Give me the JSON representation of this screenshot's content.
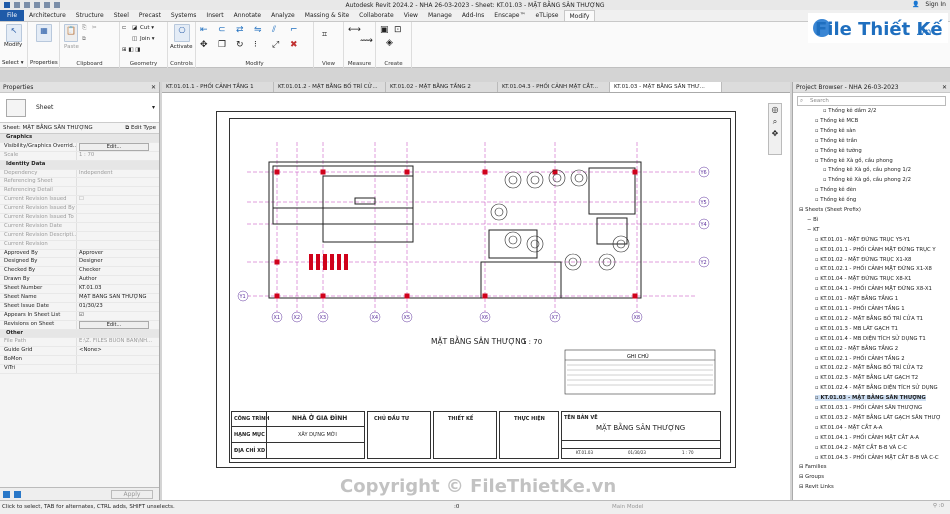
{
  "title_bar": {
    "title": "Autodesk Revit 2024.2 - NHA 26-03-2023 - Sheet: KT.01.03 - MẶT BẰNG SÂN THƯỢNG",
    "sign_in": "Sign In"
  },
  "menu": [
    "File",
    "Architecture",
    "Structure",
    "Steel",
    "Precast",
    "Systems",
    "Insert",
    "Annotate",
    "Analyze",
    "Massing & Site",
    "Collaborate",
    "View",
    "Manage",
    "Add-Ins",
    "Enscape™",
    "eTLipse",
    "Modify"
  ],
  "active_menu": "Modify",
  "ribbon": {
    "select_label": "Select ▾",
    "modify_label": "Modify",
    "properties_label": "Properties",
    "clipboard_label": "Clipboard",
    "paste_label": "Paste",
    "cut_label": "Cut ▾",
    "join_label": "Join ▾",
    "geometry_label": "Geometry",
    "controls_label": "Controls",
    "activate_label": "Activate",
    "modify_group_label": "Modify",
    "view_label": "View",
    "measure_label": "Measure",
    "create_label": "Create"
  },
  "tabs": [
    {
      "label": "KT.01.01.1 - PHỐI CẢNH TẦNG 1"
    },
    {
      "label": "KT.01.01.2 - MẶT BẰNG BỐ TRÍ CỬ..."
    },
    {
      "label": "KT.01.02 - MẶT BẰNG TẦNG 2"
    },
    {
      "label": "KT.01.04.3 - PHỐI CẢNH MẶT CẮT..."
    },
    {
      "label": "KT.01.03 - MẶT BẰNG SÂN THƯ..."
    }
  ],
  "properties": {
    "header": "Properties",
    "type_name": "Sheet",
    "selector": "Sheet: MẶT BẰNG SÂN THƯỢNG",
    "edit_type": "Edit Type",
    "rows": [
      {
        "k": "Graphics",
        "v": "",
        "sec": true
      },
      {
        "k": "Visibility/Graphics Overrid...",
        "v": "Edit...",
        "btn": true
      },
      {
        "k": "Scale",
        "v": "1 : 70",
        "dim": true
      },
      {
        "k": "Identity Data",
        "v": "",
        "sec": true
      },
      {
        "k": "Dependency",
        "v": "Independent",
        "dim": true
      },
      {
        "k": "Referencing Sheet",
        "v": "",
        "dim": true
      },
      {
        "k": "Referencing Detail",
        "v": "",
        "dim": true
      },
      {
        "k": "Current Revision Issued",
        "v": "☐",
        "dim": true
      },
      {
        "k": "Current Revision Issued By",
        "v": "",
        "dim": true
      },
      {
        "k": "Current Revision Issued To",
        "v": "",
        "dim": true
      },
      {
        "k": "Current Revision Date",
        "v": "",
        "dim": true
      },
      {
        "k": "Current Revision Descripti...",
        "v": "",
        "dim": true
      },
      {
        "k": "Current Revision",
        "v": "",
        "dim": true
      },
      {
        "k": "Approved By",
        "v": "Approver"
      },
      {
        "k": "Designed By",
        "v": "Designer"
      },
      {
        "k": "Checked By",
        "v": "Checker"
      },
      {
        "k": "Drawn By",
        "v": "Author"
      },
      {
        "k": "Sheet Number",
        "v": "KT.01.03"
      },
      {
        "k": "Sheet Name",
        "v": "MẶT BẰNG SÂN THƯỢNG"
      },
      {
        "k": "Sheet Issue Date",
        "v": "01/30/23"
      },
      {
        "k": "Appears In Sheet List",
        "v": "☑"
      },
      {
        "k": "Revisions on Sheet",
        "v": "Edit...",
        "btn": true
      },
      {
        "k": "Other",
        "v": "",
        "sec": true
      },
      {
        "k": "File Path",
        "v": "E:\\Z. FILES BUON BAN\\NH...",
        "dim": true
      },
      {
        "k": "Guide Grid",
        "v": "<None>"
      },
      {
        "k": "BoMon",
        "v": ""
      },
      {
        "k": "ViTri",
        "v": ""
      }
    ],
    "apply": "Apply"
  },
  "drawing": {
    "plan_title": "MẶT BẰNG SÂN THƯỢNG",
    "plan_scale": "1 : 70",
    "grid_x": [
      "X1",
      "X2",
      "X3",
      "X4",
      "X5",
      "X6",
      "X7",
      "X8"
    ],
    "grid_y": [
      "Y6",
      "Y5",
      "Y4",
      "Y2",
      "Y1"
    ],
    "notes_title": "GHI CHÚ",
    "titleblock": {
      "cong_trinh_label": "CÔNG TRÌNH",
      "cong_trinh_value": "NHÀ Ở GIA ĐÌNH",
      "hang_muc_label": "HẠNG MỤC",
      "hang_muc_value": "XÂY DỰNG MỚI",
      "dia_chi_label": "ĐỊA CHỈ XD",
      "chu_dau_tu": "CHỦ ĐẦU TƯ",
      "thiet_ke": "THIẾT KẾ",
      "thuc_hien": "THỰC HIỆN",
      "ten_ban_ve_label": "TÊN BẢN VẼ",
      "ten_ban_ve_value": "MẶT BẰNG SÂN THƯỢNG",
      "sheet_no": "KT.01.03",
      "date": "01/30/23",
      "scale": "1 : 70"
    }
  },
  "project_browser": {
    "header": "Project Browser - NHA 26-03-2023",
    "search_placeholder": "Search",
    "items": [
      {
        "t": "Thống kê dầm 2/2",
        "ind": 3
      },
      {
        "t": "Thống kê MCB",
        "ind": 2
      },
      {
        "t": "Thống kê sàn",
        "ind": 2
      },
      {
        "t": "Thống kê trần",
        "ind": 2
      },
      {
        "t": "Thống kê tường",
        "ind": 2
      },
      {
        "t": "Thống kê Xà gồ, cầu phong",
        "ind": 2
      },
      {
        "t": "Thống kê Xà gồ, cầu phong 1/2",
        "ind": 3
      },
      {
        "t": "Thống kê Xà gồ, cầu phong 2/2",
        "ind": 3
      },
      {
        "t": "Thống kê đèn",
        "ind": 2
      },
      {
        "t": "Thống kê ống",
        "ind": 2
      },
      {
        "t": "Sheets (Sheet Prefix)",
        "ind": 0
      },
      {
        "t": "Bì",
        "ind": 1
      },
      {
        "t": "KT",
        "ind": 1
      },
      {
        "t": "KT.01.01 - MẶT ĐỨNG TRỤC Y5-Y1",
        "ind": 2
      },
      {
        "t": "KT.01.01.1 - PHỐI CẢNH MẶT ĐỨNG TRỤC Y",
        "ind": 2
      },
      {
        "t": "KT.01.02 - MẶT ĐỨNG TRỤC X1-X8",
        "ind": 2
      },
      {
        "t": "KT.01.02.1 - PHỐI CẢNH MẶT ĐỨNG X1-X8",
        "ind": 2
      },
      {
        "t": "KT.01.04 - MẶT ĐỨNG TRỤC X8-X1",
        "ind": 2
      },
      {
        "t": "KT.01.04.1 - PHỐI CẢNH MẶT ĐỨNG X8-X1",
        "ind": 2
      },
      {
        "t": "KT.01.01 - MẶT BẰNG TẦNG 1",
        "ind": 2
      },
      {
        "t": "KT.01.01.1 - PHỐI CẢNH TẦNG 1",
        "ind": 2
      },
      {
        "t": "KT.01.01.2 - MẶT BẰNG BỐ TRÍ CỬA T1",
        "ind": 2
      },
      {
        "t": "KT.01.01.3 - MB LÁT GẠCH T1",
        "ind": 2
      },
      {
        "t": "KT.01.01.4 - MB DIỆN TÍCH SỬ DỤNG T1",
        "ind": 2
      },
      {
        "t": "KT.01.02 - MẶT BẰNG TẦNG 2",
        "ind": 2
      },
      {
        "t": "KT.01.02.1 - PHỐI CẢNH TẦNG 2",
        "ind": 2
      },
      {
        "t": "KT.01.02.2 - MẶT BẰNG BỐ TRÍ CỬA T2",
        "ind": 2
      },
      {
        "t": "KT.01.02.3 - MẶT BẰNG LÁT GẠCH T2",
        "ind": 2
      },
      {
        "t": "KT.01.02.4 - MẶT BẰNG DIỆN TÍCH SỬ DỤNG",
        "ind": 2
      },
      {
        "t": "KT.01.03 - MẶT BẰNG SÂN THƯỢNG",
        "ind": 2,
        "sel": true
      },
      {
        "t": "KT.01.03.1 - PHỐI CẢNH SÂN THƯỢNG",
        "ind": 2
      },
      {
        "t": "KT.01.03.2 - MẶT BẰNG LÁT GẠCH SÂN THƯỢ",
        "ind": 2
      },
      {
        "t": "KT.01.04 - MẶT CẮT A-A",
        "ind": 2
      },
      {
        "t": "KT.01.04.1 - PHỐI CẢNH MẶT CẮT A-A",
        "ind": 2
      },
      {
        "t": "KT.01.04.2 - MẶT CẮT B-B VÀ C-C",
        "ind": 2
      },
      {
        "t": "KT.01.04.3 - PHỐI CẢNH MẶT CẮT B-B VÀ C-C",
        "ind": 2
      },
      {
        "t": "Families",
        "ind": 0
      },
      {
        "t": "Groups",
        "ind": 0
      },
      {
        "t": "Revit Links",
        "ind": 0
      }
    ]
  },
  "status": {
    "hint": "Click to select, TAB for alternates, CTRL adds, SHIFT unselects.",
    "model": "Main Model",
    "zero": ":0"
  },
  "logo": {
    "brand": "File Thiết Kế",
    "suffix": ".vn"
  },
  "watermark": "Copyright © FileThietKe.vn"
}
